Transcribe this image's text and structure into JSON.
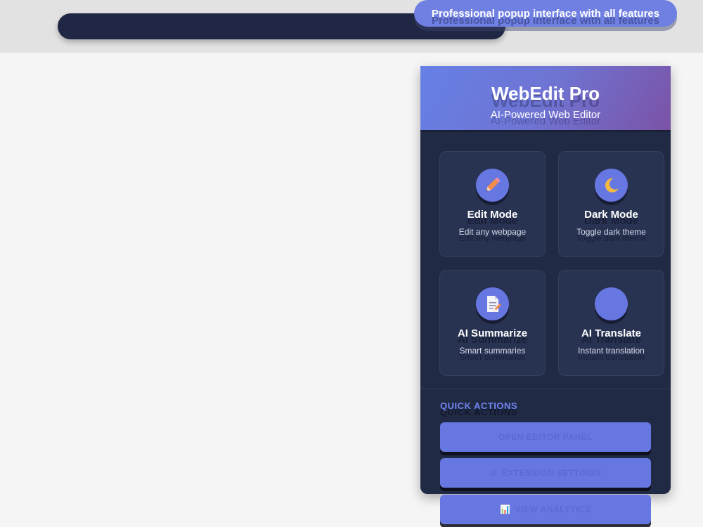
{
  "top_badge": {
    "text": "Professional popup interface with all features"
  },
  "header": {
    "title": "WebEdit Pro",
    "subtitle": "AI-Powered Web Editor"
  },
  "features": [
    {
      "title": "Edit Mode",
      "desc": "Edit any webpage",
      "icon": "pencil-icon"
    },
    {
      "title": "Dark Mode",
      "desc": "Toggle dark theme",
      "icon": "crescent-moon-icon"
    },
    {
      "title": "AI Summarize",
      "desc": "Smart summaries",
      "icon": "document-icon"
    },
    {
      "title": "AI Translate",
      "desc": "Instant translation",
      "icon": "globe-icon"
    }
  ],
  "quick_actions": {
    "title": "QUICK ACTIONS",
    "buttons": [
      {
        "label": "OPEN EDITOR PANEL",
        "icon": ""
      },
      {
        "label": "EXTENSION SETTINGS",
        "icon": "⚙"
      },
      {
        "label": "VIEW ANALYTICS",
        "icon": "📊"
      }
    ]
  },
  "colors": {
    "accent": "#6777e2",
    "popup_bg": "#212a44",
    "card_bg": "#283251",
    "header_gradient_start": "#6680e6",
    "header_gradient_end": "#7b52a6",
    "section_title": "#6f84f0"
  }
}
